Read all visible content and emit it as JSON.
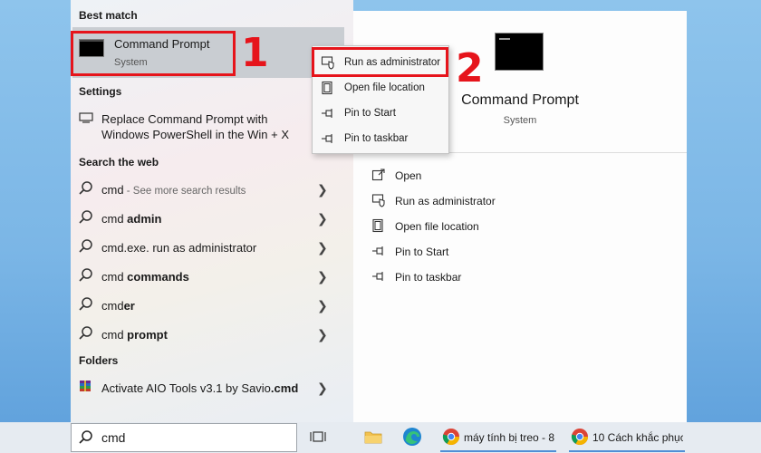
{
  "left_pane": {
    "best_match_header": "Best match",
    "best_match": {
      "title": "Command Prompt",
      "subtitle": "System"
    },
    "settings_header": "Settings",
    "settings_item": {
      "line1": "Replace Command Prompt with",
      "line2": "Windows PowerShell in the Win + X"
    },
    "search_web_header": "Search the web",
    "web_results": [
      {
        "prefix": "cmd",
        "bold": "",
        "suffix": " - See more search results"
      },
      {
        "prefix": "cmd ",
        "bold": "admin",
        "suffix": ""
      },
      {
        "prefix": "cmd.exe. run as administrator",
        "bold": "",
        "suffix": ""
      },
      {
        "prefix": "cmd ",
        "bold": "commands",
        "suffix": ""
      },
      {
        "prefix": "cmd",
        "bold": "er",
        "suffix": ""
      },
      {
        "prefix": "cmd ",
        "bold": "prompt",
        "suffix": ""
      }
    ],
    "folders_header": "Folders",
    "folder_item": {
      "prefix": "Activate AIO Tools v3.1 by Savio",
      "bold": ".cmd"
    }
  },
  "context_menu": {
    "items": [
      "Run as administrator",
      "Open file location",
      "Pin to Start",
      "Pin to taskbar"
    ]
  },
  "right_pane": {
    "app_title": "Command Prompt",
    "app_subtitle": "System",
    "actions": [
      "Open",
      "Run as administrator",
      "Open file location",
      "Pin to Start",
      "Pin to taskbar"
    ]
  },
  "annotations": {
    "step1": "1",
    "step2": "2"
  },
  "taskbar": {
    "search_value": "cmd",
    "apps": [
      "máy tính bị treo - 8...",
      "10 Cách khắc phục ..."
    ]
  },
  "icons": {
    "search": "search-icon",
    "monitor": "monitor-icon",
    "shield": "shield-icon",
    "folder": "folder-icon",
    "pin": "pin-icon",
    "open": "open-icon",
    "chevron": "chevron-right-icon",
    "chrome": "chrome-icon",
    "edge": "edge-icon",
    "explorer": "file-explorer-icon",
    "task_view": "task-view-icon",
    "winrar": "winrar-icon"
  },
  "colors": {
    "annotation_red": "#e6141b",
    "selected_row": "#c9cdd2",
    "taskbar": "#e6ebf1"
  }
}
